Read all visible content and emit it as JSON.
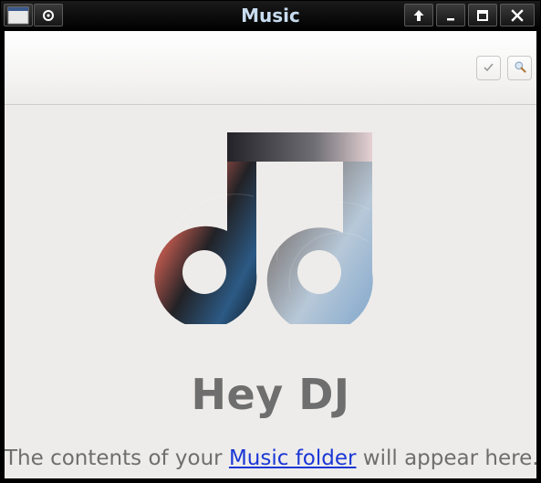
{
  "window": {
    "title": "Music",
    "buttons": {
      "menu_icon": "window-menu-icon",
      "pin_icon": "pin-icon",
      "shade_icon": "arrow-up-icon",
      "minimize_icon": "minimize-icon",
      "maximize_icon": "maximize-icon",
      "close_icon": "close-icon"
    }
  },
  "headerbar": {
    "select_icon": "checkmark-icon",
    "search_icon": "search-icon"
  },
  "empty_state": {
    "logo_icon": "music-note-icon",
    "heading": "Hey DJ",
    "text_before": "The contents of your ",
    "link_text": "Music folder",
    "text_after": " will appear here."
  },
  "colors": {
    "background": "#eeecea",
    "heading": "#6e6e6e",
    "link": "#1a37d6",
    "title_text": "#c8dcf0"
  }
}
